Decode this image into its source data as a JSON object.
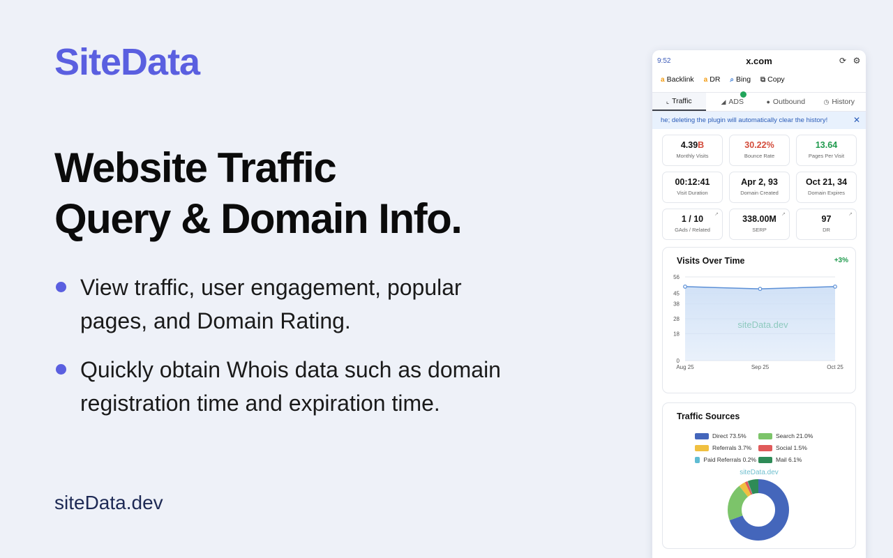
{
  "brand": "SiteData",
  "headline": [
    "Website Traffic",
    "Query & Domain Info."
  ],
  "bullets": [
    "View traffic, user engagement, popular pages, and Domain Rating.",
    "Quickly obtain Whois data such as domain registration time and expiration time."
  ],
  "site_url": "siteData.dev",
  "panel": {
    "time": "9:52",
    "domain": "x.com",
    "quicklinks": [
      {
        "label": "Backlink",
        "icon": "ahrefs-icon",
        "glyph": "a"
      },
      {
        "label": "DR",
        "icon": "ahrefs-icon",
        "glyph": "a"
      },
      {
        "label": "Bing",
        "icon": "search-icon",
        "glyph": "⌕"
      },
      {
        "label": "Copy",
        "icon": "copy-icon",
        "glyph": "⧉"
      }
    ],
    "tabs": [
      {
        "label": "Traffic",
        "icon": "chart-icon",
        "glyph": "⌞",
        "active": true
      },
      {
        "label": "ADS",
        "icon": "ads-icon",
        "glyph": "◢",
        "active": false
      },
      {
        "label": "Outbound",
        "icon": "outbound-icon",
        "glyph": "●",
        "active": false
      },
      {
        "label": "History",
        "icon": "clock-icon",
        "glyph": "◷",
        "active": false
      }
    ],
    "notice": "he; deleting the plugin will automatically clear the history!",
    "stats": [
      {
        "value": "4.39",
        "unit": "B",
        "label": "Monthly Visits",
        "style": "normal"
      },
      {
        "value": "30.22%",
        "unit": "",
        "label": "Bounce Rate",
        "style": "red"
      },
      {
        "value": "13.64",
        "unit": "",
        "label": "Pages Per Visit",
        "style": "green"
      },
      {
        "value": "00:12:41",
        "unit": "",
        "label": "Visit Duration",
        "style": "normal"
      },
      {
        "value": "Apr 2, 93",
        "unit": "",
        "label": "Domain Created",
        "style": "normal"
      },
      {
        "value": "Oct 21, 34",
        "unit": "",
        "label": "Domain Expires",
        "style": "normal"
      },
      {
        "value": "1 / 10",
        "unit": "",
        "label": "GAds / Related",
        "style": "normal",
        "ext": true
      },
      {
        "value": "338.00M",
        "unit": "",
        "label": "SERP",
        "style": "normal",
        "ext": true
      },
      {
        "value": "97",
        "unit": "",
        "label": "DR",
        "style": "normal",
        "ext": true
      }
    ],
    "colors": {
      "accent": "#5a5fe0",
      "line": "#5b8fd6",
      "area": "#cfe0f6",
      "green": "#1f9a4d",
      "red": "#d34b3a"
    }
  },
  "chart_data": [
    {
      "type": "area",
      "title": "Visits Over Time",
      "change": "+3%",
      "watermark": "siteData.dev",
      "categories": [
        "Aug 25",
        "Sep 25",
        "Oct 25"
      ],
      "values": [
        49.5,
        48,
        49.5
      ],
      "yticks": [
        "0",
        "18",
        "28",
        "38",
        "45",
        "56"
      ],
      "ylim": [
        0,
        56
      ]
    },
    {
      "type": "pie",
      "title": "Traffic Sources",
      "watermark": "siteData.dev",
      "slices": [
        {
          "name": "Direct",
          "label": "Direct 73.5%",
          "value": 73.5,
          "color": "#4466bb"
        },
        {
          "name": "Search",
          "label": "Search 21.0%",
          "value": 21.0,
          "color": "#7cc46a"
        },
        {
          "name": "Referrals",
          "label": "Referrals 3.7%",
          "value": 3.7,
          "color": "#f0c040"
        },
        {
          "name": "Social",
          "label": "Social 1.5%",
          "value": 1.5,
          "color": "#e05a5a"
        },
        {
          "name": "Paid Referrals",
          "label": "Paid Referrals 0.2%",
          "value": 0.2,
          "color": "#5fbcd3"
        },
        {
          "name": "Mail",
          "label": "Mail 6.1%",
          "value": 6.1,
          "color": "#2e8b57"
        }
      ]
    }
  ]
}
